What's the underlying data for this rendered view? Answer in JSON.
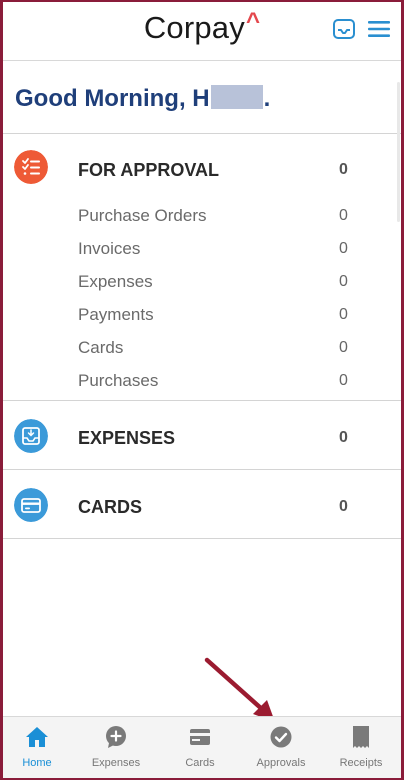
{
  "header": {
    "logo_text": "Corpay",
    "logo_caret": "^",
    "brand_color": "#e4474d"
  },
  "greeting": {
    "prefix": "Good Morning, H",
    "suffix": "."
  },
  "for_approval": {
    "title": "FOR APPROVAL",
    "count": "0",
    "icon": "checklist-icon",
    "icon_color": "#ee5a36",
    "items": [
      {
        "label": "Purchase Orders",
        "count": "0"
      },
      {
        "label": "Invoices",
        "count": "0"
      },
      {
        "label": "Expenses",
        "count": "0"
      },
      {
        "label": "Payments",
        "count": "0"
      },
      {
        "label": "Cards",
        "count": "0"
      },
      {
        "label": "Purchases",
        "count": "0"
      }
    ]
  },
  "expenses": {
    "title": "EXPENSES",
    "count": "0",
    "icon": "inbox-icon",
    "icon_color": "#3b9ad9"
  },
  "cards": {
    "title": "CARDS",
    "count": "0",
    "icon": "credit-card-icon",
    "icon_color": "#3b9ad9"
  },
  "nav": {
    "home": "Home",
    "expenses": "Expenses",
    "cards": "Cards",
    "approvals": "Approvals",
    "receipts": "Receipts",
    "active_color": "#1a8fd6",
    "inactive_color": "#777777"
  },
  "annotation": {
    "arrow_color": "#9b1b30"
  }
}
